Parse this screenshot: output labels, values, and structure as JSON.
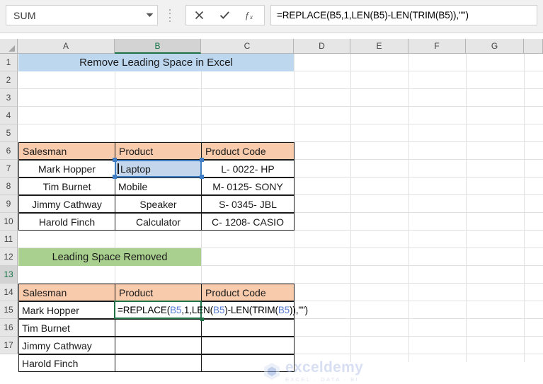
{
  "formula_bar": {
    "name_box_value": "SUM",
    "name_box_dropdown_icon": "chevron-down-icon",
    "cancel_icon": "x-icon",
    "enter_icon": "check-icon",
    "insert_function_icon": "fx-icon",
    "formula_value": "=REPLACE(B5,1,LEN(B5)-LEN(TRIM(B5)),\"\")"
  },
  "grid": {
    "columns": [
      "A",
      "B",
      "C",
      "D",
      "E",
      "F",
      "G"
    ],
    "active_column": "B",
    "rows": [
      "1",
      "2",
      "3",
      "4",
      "5",
      "6",
      "7",
      "8",
      "9",
      "10",
      "11",
      "12",
      "13",
      "14",
      "15",
      "16",
      "17"
    ],
    "active_row": "13",
    "select_all_icon": "select-all-triangle-icon"
  },
  "banners": {
    "title": "Remove Leading Space in Excel",
    "title_color": "#BDD7EE",
    "subtitle": "Leading Space Removed",
    "subtitle_color": "#A9D08E"
  },
  "table1": {
    "header_color": "#F8CBAD",
    "headers": [
      "Salesman",
      "Product",
      "Product Code"
    ],
    "rows": [
      {
        "salesman": "Mark Hopper",
        "product": "Laptop",
        "code": "L-  0022-  HP"
      },
      {
        "salesman": "Tim Burnet",
        "product": "Mobile",
        "code": "M-  0125- SONY"
      },
      {
        "salesman": "Jimmy Cathway",
        "product": "Speaker",
        "code": "S- 0345-  JBL"
      },
      {
        "salesman": "Harold Finch",
        "product": "Calculator",
        "code": "C- 1208- CASIO"
      }
    ]
  },
  "table2": {
    "header_color": "#F8CBAD",
    "headers": [
      "Salesman",
      "Product",
      "Product Code"
    ],
    "rows": [
      {
        "salesman": "Mark Hopper",
        "product": "",
        "code": ""
      },
      {
        "salesman": "Tim Burnet",
        "product": "",
        "code": ""
      },
      {
        "salesman": "Jimmy Cathway",
        "product": "",
        "code": ""
      },
      {
        "salesman": "Harold Finch",
        "product": "",
        "code": ""
      }
    ]
  },
  "selected_cell": {
    "reference": "B5",
    "value": "Laptop",
    "border_color": "#3F7EC4"
  },
  "active_cell": {
    "reference": "B13",
    "border_color": "#1E7145",
    "formula_tokens": [
      {
        "t": "=REPLACE(",
        "c": "black"
      },
      {
        "t": "B5",
        "c": "blue"
      },
      {
        "t": ",1,LEN(",
        "c": "black"
      },
      {
        "t": "B5",
        "c": "blue"
      },
      {
        "t": ")-LEN(TRIM(",
        "c": "black"
      },
      {
        "t": "B5",
        "c": "blue"
      },
      {
        "t": ")),\"\")",
        "c": "black"
      }
    ]
  },
  "watermark": {
    "brand": "exceldemy",
    "tagline": "EXCEL · DATA · BI",
    "logo_icon": "exceldemy-hex-logo-icon"
  }
}
